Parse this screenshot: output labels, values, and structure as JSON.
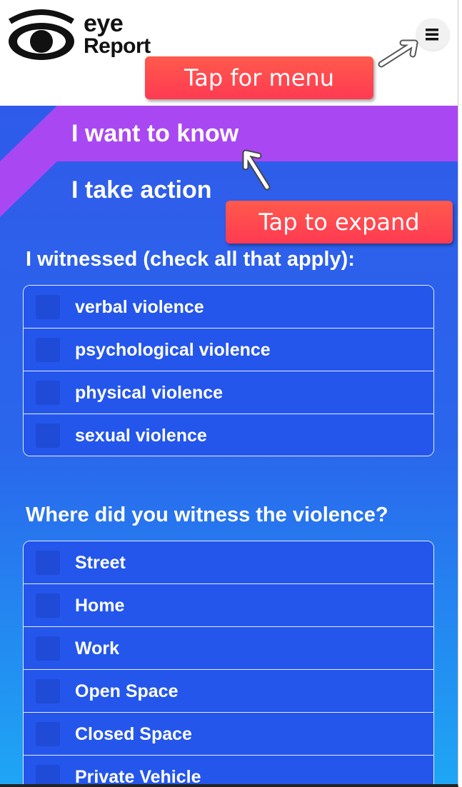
{
  "header": {
    "logo_line1": "eye",
    "logo_line2": "Report",
    "menu_icon": "hamburger-menu-icon"
  },
  "tips": {
    "menu": "Tap for menu",
    "expand": "Tap to expand"
  },
  "tabs": {
    "know": "I want to know",
    "action": "I take action"
  },
  "witnessed": {
    "title": "I witnessed (check all that apply):",
    "items": [
      "verbal violence",
      "psychological violence",
      "physical violence",
      "sexual violence"
    ]
  },
  "where": {
    "title": "Where did you witness the violence?",
    "items": [
      "Street",
      "Home",
      "Work",
      "Open Space",
      "Closed Space",
      "Private Vehicle"
    ]
  },
  "colors": {
    "accent_purple": "#a948f2",
    "primary_blue": "#2456ec",
    "tip_red": "#ff3a52"
  }
}
